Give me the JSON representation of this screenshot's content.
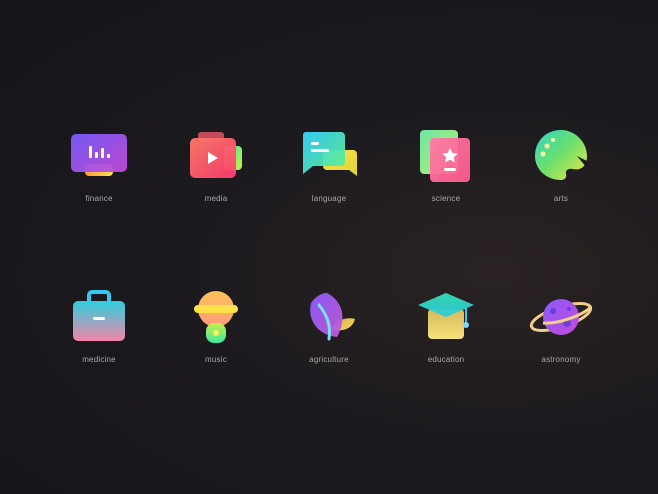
{
  "icons": [
    {
      "label": "finance",
      "icon": "finance-icon"
    },
    {
      "label": "media",
      "icon": "media-icon"
    },
    {
      "label": "language",
      "icon": "language-icon"
    },
    {
      "label": "science",
      "icon": "science-icon"
    },
    {
      "label": "arts",
      "icon": "arts-icon"
    },
    {
      "label": "medicine",
      "icon": "medicine-icon"
    },
    {
      "label": "music",
      "icon": "music-icon"
    },
    {
      "label": "agriculture",
      "icon": "agriculture-icon"
    },
    {
      "label": "education",
      "icon": "education-icon"
    },
    {
      "label": "astronomy",
      "icon": "astronomy-icon"
    }
  ]
}
